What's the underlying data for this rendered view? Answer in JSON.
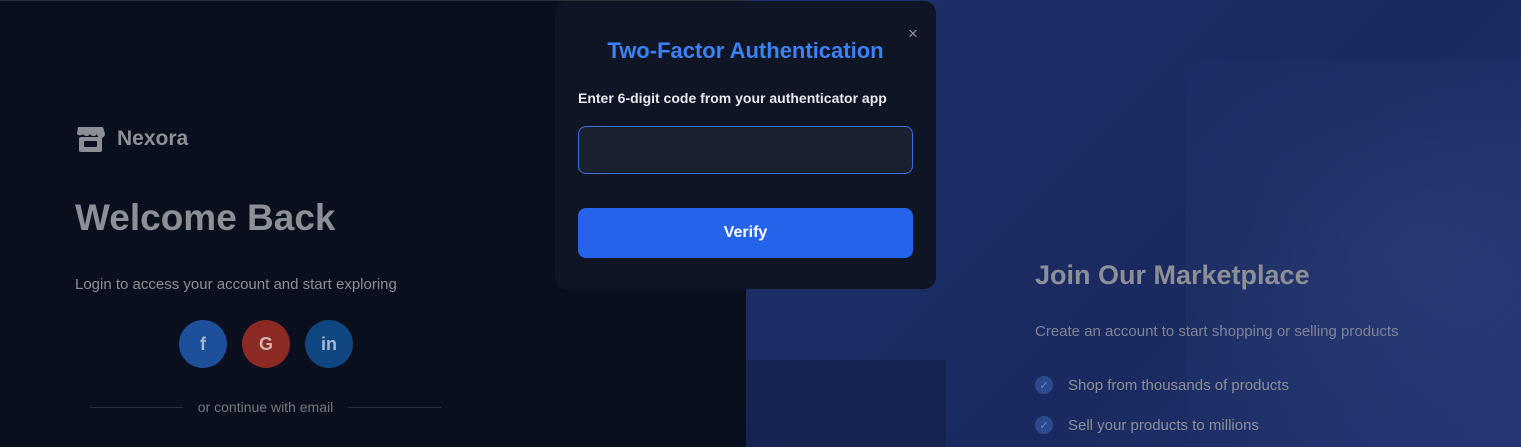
{
  "brand": {
    "name": "Nexora",
    "icon": "store-icon"
  },
  "login": {
    "title": "Welcome Back",
    "subtitle": "Login to access your account and start exploring",
    "divider_text": "or continue with email"
  },
  "socials": [
    {
      "icon": "facebook-icon",
      "glyph": "f"
    },
    {
      "icon": "google-icon",
      "glyph": "G"
    },
    {
      "icon": "linkedin-icon",
      "glyph": "in"
    }
  ],
  "marketing": {
    "title": "Join Our Marketplace",
    "subtitle": "Create an account to start shopping or selling products",
    "features": [
      "Shop from thousands of products",
      "Sell your products to millions"
    ]
  },
  "modal": {
    "title": "Two-Factor Authentication",
    "close_glyph": "×",
    "label": "Enter 6-digit code from your authenticator app",
    "input_value": "",
    "input_placeholder": "",
    "verify_label": "Verify"
  },
  "colors": {
    "accent": "#3b82f6",
    "button": "#2563eb",
    "facebook": "#1d4f9a",
    "google": "#8a2a22",
    "linkedin": "#0f4580"
  }
}
